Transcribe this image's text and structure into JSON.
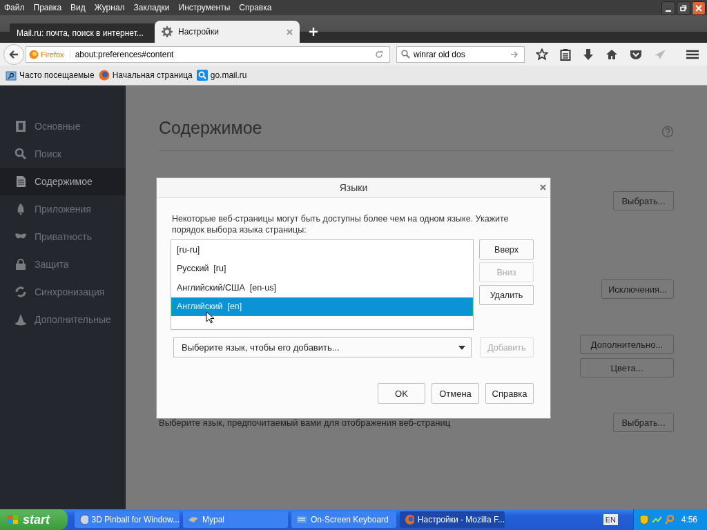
{
  "menu_bar": [
    "Файл",
    "Правка",
    "Вид",
    "Журнал",
    "Закладки",
    "Инструменты",
    "Справка"
  ],
  "tabs": [
    {
      "label": "Mail.ru: почта, поиск в интернет...",
      "selected": false
    },
    {
      "label": "Настройки",
      "selected": true
    }
  ],
  "nav_bar": {
    "identity": "Firefox",
    "url": "about:preferences#content",
    "search": "winrar oid dos"
  },
  "bookmarks": [
    {
      "label": "Часто посещаемые"
    },
    {
      "label": "Начальная страница"
    },
    {
      "label": "go.mail.ru"
    }
  ],
  "sidebar": [
    {
      "label": "Основные",
      "selected": false
    },
    {
      "label": "Поиск",
      "selected": false
    },
    {
      "label": "Содержимое",
      "selected": true
    },
    {
      "label": "Приложения",
      "selected": false
    },
    {
      "label": "Приватность",
      "selected": false
    },
    {
      "label": "Защита",
      "selected": false
    },
    {
      "label": "Синхронизация",
      "selected": false
    },
    {
      "label": "Дополнительные",
      "selected": false
    }
  ],
  "page": {
    "title": "Содержимое",
    "choose_button": "Выбрать...",
    "exceptions_button": "Исключения...",
    "advanced_button": "Дополнительно...",
    "colors_button": "Цвета...",
    "language_text": "Выберите язык, предпочитаемый вами для отображения веб-страниц",
    "language_button": "Выбрать..."
  },
  "dialog": {
    "title": "Языки",
    "description": "Некоторые веб-страницы могут быть доступны более чем на одном языке. Укажите порядок выбора языка страницы:",
    "languages": [
      {
        "label": "[ru-ru]",
        "selected": false
      },
      {
        "label": "Русский  [ru]",
        "selected": false
      },
      {
        "label": "Английский/США  [en-us]",
        "selected": false
      },
      {
        "label": "Английский  [en]",
        "selected": true
      }
    ],
    "side_buttons": [
      {
        "label": "Вверх",
        "disabled": false
      },
      {
        "label": "Вниз",
        "disabled": true
      },
      {
        "label": "Удалить",
        "disabled": false
      }
    ],
    "select_placeholder": "Выберите язык, чтобы его добавить...",
    "add_button": {
      "label": "Добавить",
      "disabled": true
    },
    "footer_buttons": [
      "OK",
      "Отмена",
      "Справка"
    ]
  },
  "taskbar": {
    "start": "start",
    "tasks": [
      {
        "label": "3D Pinball for Window...",
        "selected": false
      },
      {
        "label": "Mypal",
        "selected": false
      },
      {
        "label": "On-Screen Keyboard",
        "selected": false
      },
      {
        "label": "Настройки - Mozilla F...",
        "selected": true
      }
    ],
    "language": "EN",
    "clock": "4:56"
  }
}
